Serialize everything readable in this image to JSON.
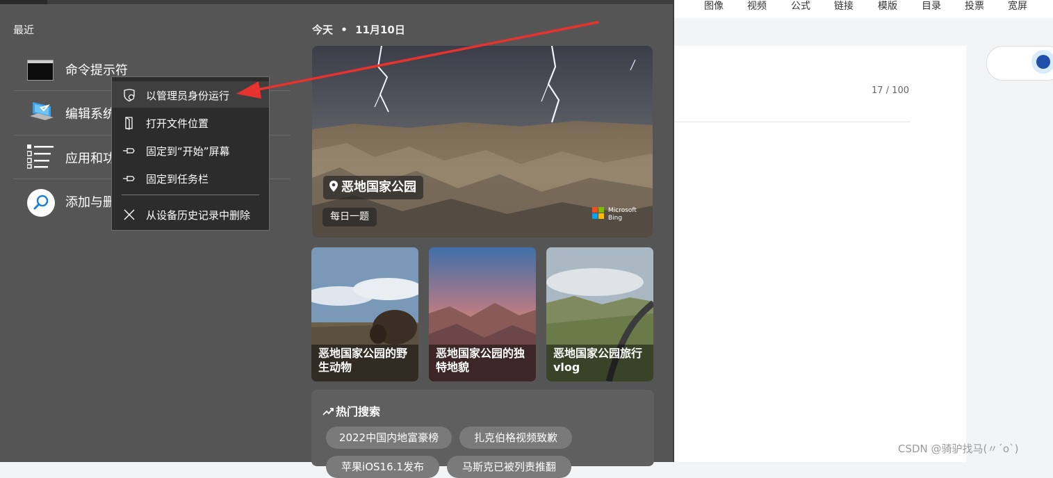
{
  "editor": {
    "toolbar": [
      "图像",
      "视频",
      "公式",
      "链接",
      "模版",
      "目录",
      "投票",
      "宽屏"
    ],
    "counter": "17 / 100",
    "watermark": "CSDN @骑驴找马(〃´o`)"
  },
  "start_menu": {
    "recent_title": "最近",
    "recent_items": [
      {
        "label": "命令提示符",
        "icon": "command-prompt-icon"
      },
      {
        "label": "编辑系统",
        "icon": "computer-settings-icon"
      },
      {
        "label": "应用和功能",
        "icon": "list-icon"
      },
      {
        "label": "添加与删除",
        "icon": "search-icon"
      }
    ],
    "context_menu": [
      {
        "label": "以管理员身份运行",
        "icon": "shield-icon"
      },
      {
        "label": "打开文件位置",
        "icon": "file-location-icon"
      },
      {
        "label": "固定到“开始”屏幕",
        "icon": "pin-icon"
      },
      {
        "label": "固定到任务栏",
        "icon": "pin-icon"
      },
      {
        "label": "从设备历史记录中删除",
        "icon": "close-icon"
      }
    ],
    "date": {
      "today": "今天",
      "dot": "•",
      "date": "11月10日"
    },
    "hero": {
      "title": "恶地国家公园",
      "subtitle": "每日一题",
      "brand_line1": "Microsoft",
      "brand_line2": "Bing"
    },
    "cards": [
      {
        "title": "恶地国家公园的野生动物"
      },
      {
        "title": "恶地国家公园的独特地貌"
      },
      {
        "title": "恶地国家公园旅行vlog"
      }
    ],
    "hot_search": {
      "title": "热门搜索",
      "chips": [
        "2022中国内地富豪榜",
        "扎克伯格视频致歉",
        "苹果iOS16.1发布",
        "马斯克已被列责推翻"
      ]
    }
  },
  "colors": {
    "menu_bg": "#555555",
    "context_bg": "#2c2c2c",
    "arrow": "#e8322e"
  }
}
